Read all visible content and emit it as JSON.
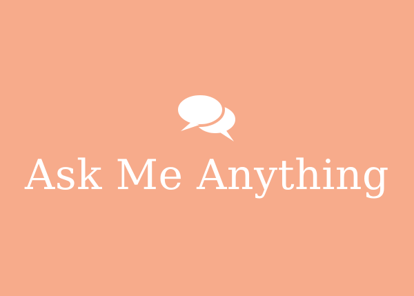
{
  "colors": {
    "background": "#f7ab8b",
    "foreground": "#ffffff"
  },
  "graphic": {
    "icon": "chat-bubbles-icon"
  },
  "headline": {
    "text": "Ask Me Anything"
  }
}
